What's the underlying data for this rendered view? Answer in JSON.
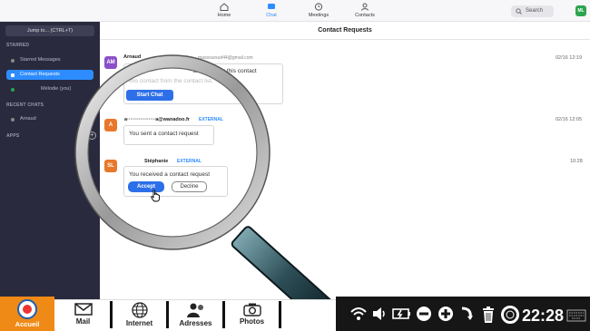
{
  "nav": {
    "tabs": [
      {
        "label": "Home",
        "icon": "home-icon"
      },
      {
        "label": "Chat",
        "icon": "chat-icon"
      },
      {
        "label": "Meetings",
        "icon": "clock-icon"
      },
      {
        "label": "Contacts",
        "icon": "person-icon"
      }
    ],
    "active_tab": "Chat",
    "search_placeholder": "Search",
    "avatar_initials": "ML"
  },
  "sidebar": {
    "jump_label": "Jump to... (CTRL+T)",
    "starred_heading": "STARRED",
    "starred_items": [
      {
        "label": "Starred Messages"
      },
      {
        "label": "Contact Requests"
      },
      {
        "label": "Mélodie  (you)"
      }
    ],
    "recent_heading": "RECENT CHATS",
    "recent_items": [
      {
        "label": "Arnaud"
      }
    ],
    "apps_heading": "APPS"
  },
  "content": {
    "title": "Contact Requests",
    "messages": [
      {
        "initials": "AM",
        "name": "Arnaud",
        "tag": "EXTERNAL",
        "email": "massoursud44@gmail.com",
        "date": "02/16 12:19",
        "text_line1": "Your",
        "text_line1b": "accepted by this contact",
        "text_line2": "this contact from the contact list.",
        "button": "Start Chat"
      },
      {
        "initials": "A",
        "name": "a·················a@wanadoo.fr",
        "tag": "EXTERNAL",
        "date": "02/16 12:05",
        "text": "You sent a contact request"
      },
      {
        "initials": "SL",
        "name": "Stéphanie",
        "tag": "EXTERNAL",
        "date": "10:28",
        "text": "You received a contact request",
        "accept": "Accept",
        "decline": "Decline"
      }
    ]
  },
  "taskbar": {
    "home": "Accueil",
    "apps": [
      "Mail",
      "Internet",
      "Adresses",
      "Photos"
    ],
    "clock": "22:28"
  },
  "colors": {
    "accent": "#2d8cff",
    "sidebar": "#2a2a3e",
    "accueil": "#f08a16"
  }
}
